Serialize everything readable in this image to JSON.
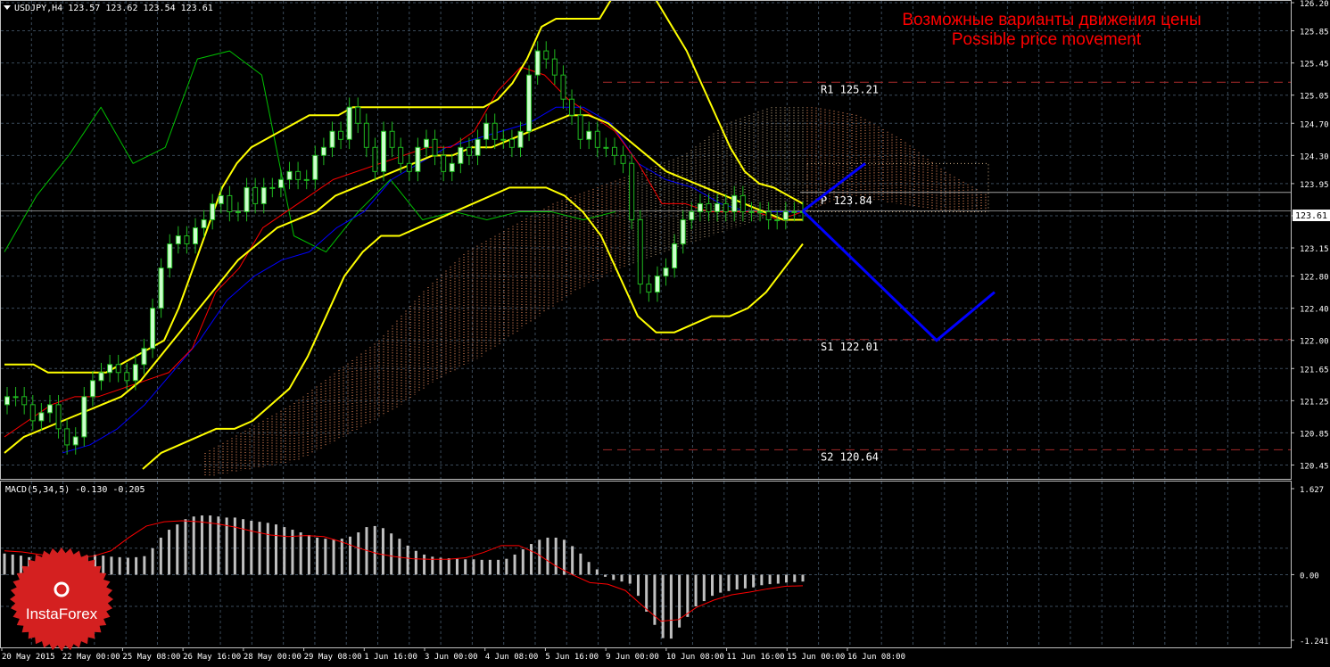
{
  "header": {
    "symbol_line": "USDJPY,H4  123.57 123.62 123.54 123.61",
    "title_ru": "Возможные варианты движения цены",
    "title_en": "Possible price movement"
  },
  "macd_header": "MACD(5,34,5) -0.130 -0.205",
  "logo_text": "InstaForex",
  "current_price_label": "123.61",
  "colors": {
    "background": "#000000",
    "grid": "#3a4a5a",
    "bull_candle": "#ccffcc",
    "bear_candle": "#1fb81f",
    "bollinger": "#ffff00",
    "tenkan": "#ff0000",
    "kijun": "#0000ff",
    "chikou": "#00c000",
    "cloud_bull": "#ff9966",
    "cloud_bear": "#d2b48c",
    "forecast": "#0000ff",
    "levels": "#a52a2a",
    "macd_hist": "#c0c0c0",
    "macd_signal": "#ff0000",
    "title_text": "#ff0000",
    "logo_red": "#d42020"
  },
  "chart_data": [
    {
      "type": "candlestick",
      "symbol": "USDJPY",
      "timeframe": "H4",
      "ylim": [
        120.3,
        126.2
      ],
      "y_tick_labels": [
        "126.20",
        "125.85",
        "125.45",
        "125.05",
        "124.70",
        "124.30",
        "123.95",
        "123.55",
        "123.15",
        "122.80",
        "122.40",
        "122.00",
        "121.65",
        "121.25",
        "120.85",
        "120.45"
      ],
      "x_tick_labels": [
        "20 May 2015",
        "22 May 00:00",
        "25 May 08:00",
        "26 May 16:00",
        "28 May 00:00",
        "29 May 08:00",
        "1 Jun 16:00",
        "3 Jun 00:00",
        "4 Jun 08:00",
        "5 Jun 16:00",
        "9 Jun 00:00",
        "10 Jun 08:00",
        "11 Jun 16:00",
        "15 Jun 00:00",
        "16 Jun 08:00"
      ],
      "close": [
        121.3,
        121.3,
        121.2,
        121.0,
        121.1,
        121.2,
        120.9,
        120.7,
        120.8,
        121.3,
        121.5,
        121.6,
        121.7,
        121.6,
        121.5,
        121.7,
        121.9,
        122.4,
        122.9,
        123.2,
        123.3,
        123.2,
        123.4,
        123.5,
        123.7,
        123.8,
        123.6,
        123.6,
        123.9,
        123.7,
        123.9,
        123.9,
        124.0,
        124.1,
        124.0,
        124.0,
        124.3,
        124.4,
        124.6,
        124.5,
        124.9,
        124.7,
        124.4,
        124.1,
        124.6,
        124.4,
        124.2,
        124.1,
        124.4,
        124.5,
        124.3,
        124.1,
        124.2,
        124.4,
        124.3,
        124.5,
        124.7,
        124.5,
        124.5,
        124.4,
        124.6,
        125.3,
        125.6,
        125.5,
        125.3,
        125.0,
        124.8,
        124.5,
        124.6,
        124.4,
        124.4,
        124.3,
        124.2,
        123.5,
        122.7,
        122.6,
        122.8,
        122.9,
        123.2,
        123.5,
        123.6,
        123.7,
        123.6,
        123.7,
        123.6,
        123.8,
        123.6,
        123.6,
        123.6,
        123.5,
        123.5,
        123.6,
        123.6,
        123.6
      ],
      "bollinger_upper": [
        121.7,
        121.7,
        121.7,
        121.6,
        121.6,
        121.6,
        121.6,
        121.6,
        121.7,
        121.8,
        121.9,
        122.0,
        122.4,
        122.9,
        123.4,
        123.9,
        124.2,
        124.4,
        124.5,
        124.6,
        124.7,
        124.8,
        124.8,
        124.8,
        124.9,
        124.9,
        124.9,
        124.9,
        124.9,
        124.9,
        124.9,
        124.9,
        124.9,
        124.9,
        125.0,
        125.2,
        125.5,
        125.9,
        126.0,
        126.0,
        126.0,
        126.0,
        126.3,
        126.6,
        126.5,
        126.2,
        125.9,
        125.6,
        125.2,
        124.8,
        124.4,
        124.1,
        123.95,
        123.9,
        123.8,
        123.7
      ],
      "bollinger_middle": [
        120.6,
        120.8,
        120.9,
        121.0,
        121.1,
        121.2,
        121.3,
        121.5,
        121.8,
        122.1,
        122.4,
        122.7,
        123.0,
        123.2,
        123.4,
        123.5,
        123.6,
        123.8,
        123.9,
        124.0,
        124.1,
        124.2,
        124.3,
        124.3,
        124.4,
        124.4,
        124.5,
        124.6,
        124.7,
        124.8,
        124.8,
        124.7,
        124.5,
        124.3,
        124.1,
        124.0,
        123.9,
        123.8,
        123.7,
        123.6,
        123.5,
        123.5
      ],
      "bollinger_lower": [
        120.4,
        120.6,
        120.7,
        120.8,
        120.9,
        120.9,
        121.0,
        121.2,
        121.4,
        121.8,
        122.3,
        122.8,
        123.1,
        123.3,
        123.3,
        123.4,
        123.5,
        123.6,
        123.7,
        123.8,
        123.9,
        123.9,
        123.9,
        123.8,
        123.6,
        123.3,
        122.8,
        122.3,
        122.1,
        122.1,
        122.2,
        122.3,
        122.3,
        122.4,
        122.6,
        122.9,
        123.2
      ],
      "tenkan_sen": [
        120.8,
        121.0,
        121.2,
        121.3,
        121.3,
        121.4,
        121.5,
        121.6,
        121.9,
        122.6,
        122.9,
        123.4,
        123.6,
        123.8,
        124.0,
        124.1,
        124.2,
        124.3,
        124.4,
        124.4,
        124.6,
        125.1,
        125.4,
        125.3,
        125.0,
        124.8,
        124.6,
        124.2,
        123.7,
        123.7,
        123.6,
        123.6,
        123.6,
        123.5,
        123.6
      ],
      "kijun_sen": [
        120.6,
        120.7,
        120.9,
        121.2,
        121.6,
        122.0,
        122.5,
        122.8,
        123.0,
        123.1,
        123.4,
        123.6,
        124.0,
        124.2,
        124.4,
        124.5,
        124.6,
        124.7,
        124.9,
        124.9,
        124.7,
        124.2,
        124.0,
        123.9,
        123.7,
        123.6,
        123.6,
        123.6
      ],
      "chikou_span": [
        123.1,
        123.8,
        124.3,
        124.9,
        124.2,
        124.4,
        125.5,
        125.6,
        125.3,
        123.3,
        123.1,
        123.6,
        124.0,
        123.5,
        123.6,
        123.5,
        123.6,
        123.6,
        123.5,
        123.6
      ],
      "cloud_top": [
        120.6,
        120.9,
        121.2,
        121.6,
        122.0,
        122.6,
        123.1,
        123.4,
        123.7,
        123.9,
        124.1,
        124.3,
        124.7,
        124.9,
        124.9,
        124.8,
        124.5,
        124.1,
        123.8
      ],
      "cloud_bottom": [
        120.3,
        120.4,
        120.5,
        120.8,
        121.1,
        121.5,
        121.8,
        122.2,
        122.6,
        122.9,
        123.1,
        123.3,
        123.5,
        123.6,
        123.8,
        123.7,
        123.6,
        123.6
      ],
      "levels": [
        {
          "name": "R1",
          "label": "R1  125.21",
          "value": 125.21
        },
        {
          "name": "P",
          "label": "P  123.84",
          "value": 123.84
        },
        {
          "name": "S1",
          "label": "S1  122.01",
          "value": 122.01
        },
        {
          "name": "S2",
          "label": "S2  120.64",
          "value": 120.64
        }
      ],
      "forecast_paths": [
        {
          "name": "up",
          "points": [
            [
              0,
              123.61
            ],
            [
              1,
              124.2
            ]
          ]
        },
        {
          "name": "down",
          "points": [
            [
              0,
              123.61
            ],
            [
              1,
              122.0
            ],
            [
              2,
              122.6
            ]
          ]
        }
      ]
    },
    {
      "type": "bar",
      "title": "MACD(5,34,5) -0.130 -0.205",
      "ylim": [
        -1.241,
        1.627
      ],
      "y_tick_labels": [
        "1.627",
        "0.00",
        "-1.241"
      ],
      "values": [
        0.4,
        0.38,
        0.36,
        0.33,
        0.3,
        0.25,
        0.2,
        0.18,
        0.24,
        0.3,
        0.36,
        0.38,
        0.36,
        0.34,
        0.33,
        0.32,
        0.33,
        0.35,
        0.5,
        0.7,
        0.85,
        0.95,
        1.05,
        1.1,
        1.12,
        1.12,
        1.1,
        1.08,
        1.08,
        1.05,
        1.02,
        1.0,
        0.98,
        0.95,
        0.9,
        0.85,
        0.8,
        0.75,
        0.7,
        0.68,
        0.67,
        0.68,
        0.72,
        0.8,
        0.9,
        0.92,
        0.88,
        0.78,
        0.68,
        0.55,
        0.45,
        0.38,
        0.34,
        0.32,
        0.31,
        0.3,
        0.29,
        0.29,
        0.28,
        0.28,
        0.28,
        0.3,
        0.38,
        0.48,
        0.58,
        0.66,
        0.7,
        0.7,
        0.66,
        0.54,
        0.4,
        0.24,
        0.1,
        -0.04,
        -0.1,
        -0.13,
        -0.17,
        -0.4,
        -0.7,
        -0.95,
        -1.2,
        -1.21,
        -1.0,
        -0.8,
        -0.6,
        -0.5,
        -0.4,
        -0.34,
        -0.31,
        -0.28,
        -0.26,
        -0.24,
        -0.2,
        -0.18,
        -0.17,
        -0.15,
        -0.14,
        -0.13
      ],
      "signal": [
        0.45,
        0.43,
        0.38,
        0.33,
        0.32,
        0.35,
        0.45,
        0.7,
        0.92,
        1.0,
        1.02,
        1.0,
        0.96,
        0.9,
        0.82,
        0.75,
        0.72,
        0.74,
        0.72,
        0.62,
        0.5,
        0.4,
        0.34,
        0.3,
        0.29,
        0.29,
        0.32,
        0.42,
        0.55,
        0.55,
        0.4,
        0.18,
        0.0,
        -0.15,
        -0.18,
        -0.3,
        -0.6,
        -0.88,
        -0.85,
        -0.62,
        -0.48,
        -0.38,
        -0.33,
        -0.27,
        -0.22,
        -0.21
      ]
    }
  ]
}
